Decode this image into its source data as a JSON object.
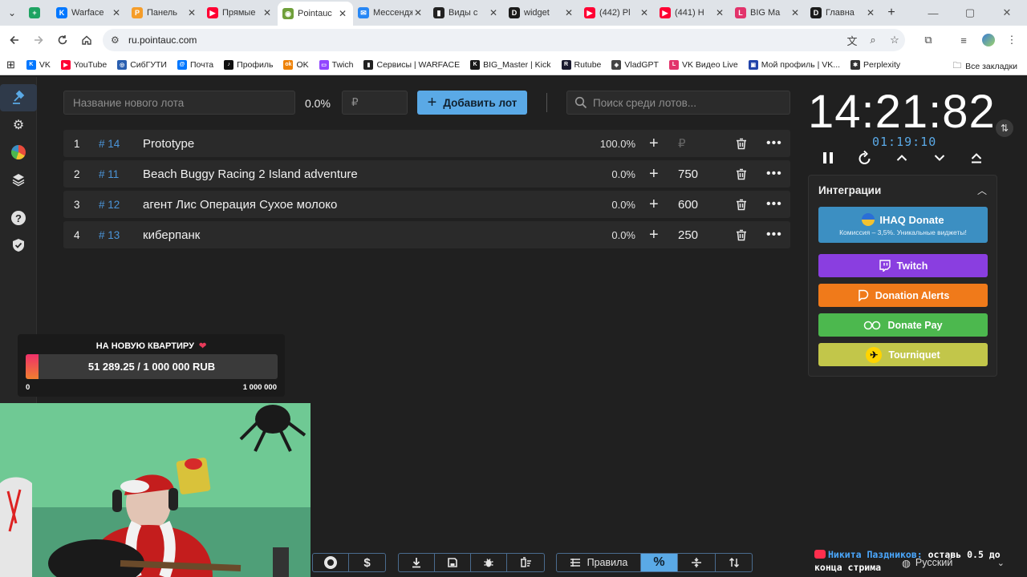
{
  "browser": {
    "tabs": [
      {
        "label": "",
        "color": "#1ea362",
        "glyph": "+"
      },
      {
        "label": "Warface",
        "color": "#0077ff",
        "glyph": "K"
      },
      {
        "label": "Панель",
        "color": "#f59d2a",
        "glyph": "P"
      },
      {
        "label": "Прямые",
        "color": "#ff0033",
        "glyph": "▶"
      },
      {
        "label": "Pointauc",
        "color": "#6f9f3a",
        "glyph": "◉",
        "active": true
      },
      {
        "label": "Мессенджер",
        "color": "#2787f5",
        "glyph": "✉"
      },
      {
        "label": "Виды с",
        "color": "#222222",
        "glyph": "▮"
      },
      {
        "label": "widget",
        "color": "#1a1a1a",
        "glyph": "D"
      },
      {
        "label": "(442) Pl",
        "color": "#ff0033",
        "glyph": "▶"
      },
      {
        "label": "(441) H",
        "color": "#ff0033",
        "glyph": "▶"
      },
      {
        "label": "BIG Ma",
        "color": "#e2336b",
        "glyph": "L"
      },
      {
        "label": "Главна",
        "color": "#1a1a1a",
        "glyph": "D"
      }
    ],
    "url": "ru.pointauc.com",
    "bookmarks": [
      {
        "label": "VK",
        "color": "#0077ff",
        "glyph": "K"
      },
      {
        "label": "YouTube",
        "color": "#ff0033",
        "glyph": "▶"
      },
      {
        "label": "СибГУТИ",
        "color": "#2a5fb0",
        "glyph": "◎"
      },
      {
        "label": "Почта",
        "color": "#0077ff",
        "glyph": "@"
      },
      {
        "label": "Профиль",
        "color": "#111111",
        "glyph": "♪"
      },
      {
        "label": "OK",
        "color": "#ee8208",
        "glyph": "ok"
      },
      {
        "label": "Twich",
        "color": "#9146ff",
        "glyph": "▭"
      },
      {
        "label": "Сервисы | WARFACE",
        "color": "#222222",
        "glyph": "▮"
      },
      {
        "label": "BIG_Master | Kick",
        "color": "#1a1a1a",
        "glyph": "K"
      },
      {
        "label": "Rutube",
        "color": "#1a1a2e",
        "glyph": "R"
      },
      {
        "label": "VladGPT",
        "color": "#444444",
        "glyph": "◈"
      },
      {
        "label": "VK Видео Live",
        "color": "#e2336b",
        "glyph": "L"
      },
      {
        "label": "Мой профиль | VK...",
        "color": "#2244aa",
        "glyph": "▣"
      },
      {
        "label": "Perplexity",
        "color": "#333333",
        "glyph": "✱"
      }
    ],
    "all_bookmarks": "Все закладки"
  },
  "toolbar": {
    "new_lot_placeholder": "Название нового лота",
    "percent": "0.0%",
    "amount_placeholder": "₽",
    "add_label": "Добавить лот",
    "search_placeholder": "Поиск среди лотов..."
  },
  "lots": [
    {
      "num": "1",
      "id": "# 14",
      "name": "Prototype",
      "pct": "100.0%",
      "amount": "₽",
      "amount_placeholder": true
    },
    {
      "num": "2",
      "id": "# 11",
      "name": "Beach Buggy Racing 2 Island adventure",
      "pct": "0.0%",
      "amount": "750"
    },
    {
      "num": "3",
      "id": "# 12",
      "name": "агент Лис Операция Сухое молоко",
      "pct": "0.0%",
      "amount": "600"
    },
    {
      "num": "4",
      "id": "# 13",
      "name": "киберпанк",
      "pct": "0.0%",
      "amount": "250"
    }
  ],
  "timer": {
    "main": "14:21:82",
    "sub": "01:19:10"
  },
  "integrations": {
    "title": "Интеграции",
    "ihaq_title": "IHAQ Donate",
    "ihaq_sub": "Комиссия – 3,5%. Уникальные виджеты!",
    "twitch": "Twitch",
    "donation_alerts": "Donation Alerts",
    "donate_pay": "Donate Pay",
    "tourniquet": "Tourniquet"
  },
  "goal": {
    "title": "НА НОВУЮ КВАРТИРУ",
    "value": "51 289.25 / 1 000 000 RUB",
    "min": "0",
    "max": "1 000 000",
    "progress": 0.0513
  },
  "bottom": {
    "rules": "Правила"
  },
  "chat": {
    "user": "Никита Паздников:",
    "text1": " оставь 0.5 до",
    "text2": "конца стрима"
  },
  "language": "Русский",
  "colors": {
    "accent": "#5aa9e6",
    "twitch": "#8a3ee0",
    "donation_alerts": "#f07a1a",
    "donate_pay": "#4cb84e",
    "tourniquet": "#c2c64a",
    "ihaq": "#3c8fc2"
  }
}
